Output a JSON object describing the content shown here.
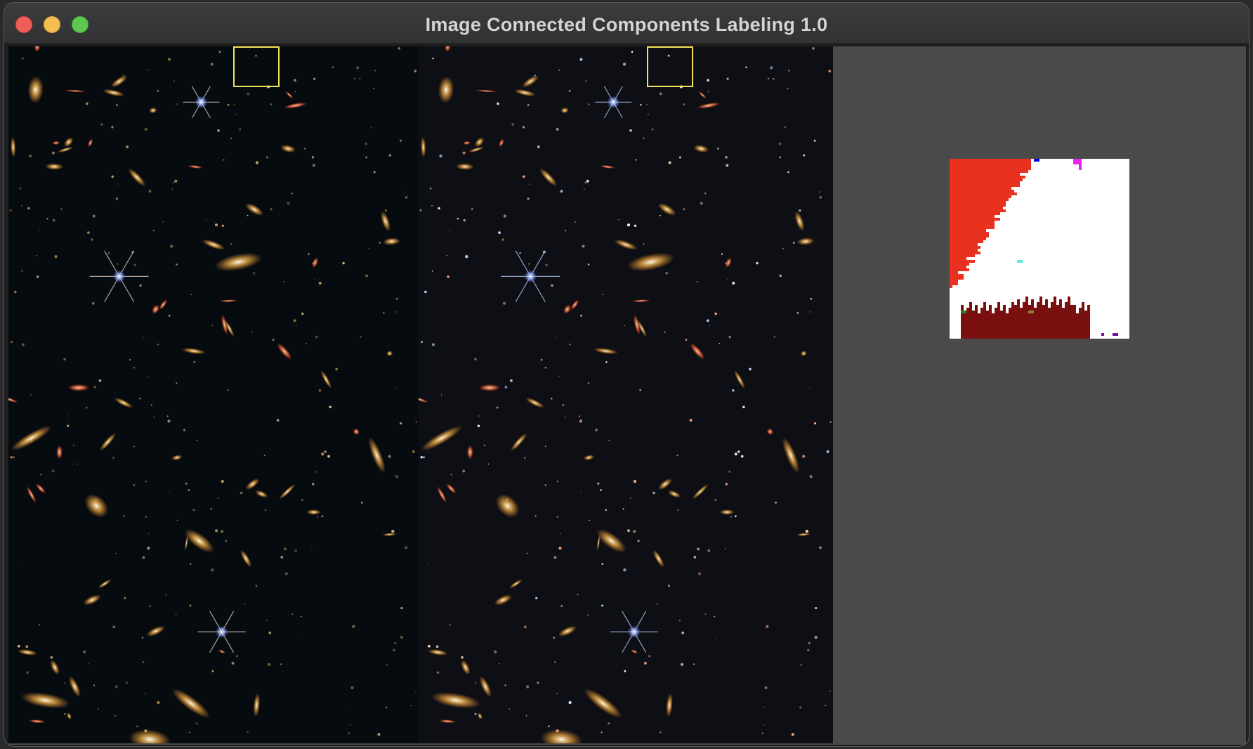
{
  "window": {
    "title": "Image Connected Components Labeling 1.0"
  },
  "panels": {
    "source_image": {
      "description": ""
    },
    "enhanced_image": {
      "description": ""
    }
  },
  "label_map": {
    "colors": {
      "background": "#ffffff",
      "component_1": "#e8321f",
      "component_2": "#7a0f0f",
      "component_3": "#0000ee",
      "component_4": "#ee22ee",
      "component_5": "#55eeee",
      "component_6": "#228822",
      "component_7": "#888833",
      "component_8": "#771199"
    }
  },
  "colors": {
    "roi_outline": "#f2e35a",
    "content_background": "#4a4a4a"
  }
}
